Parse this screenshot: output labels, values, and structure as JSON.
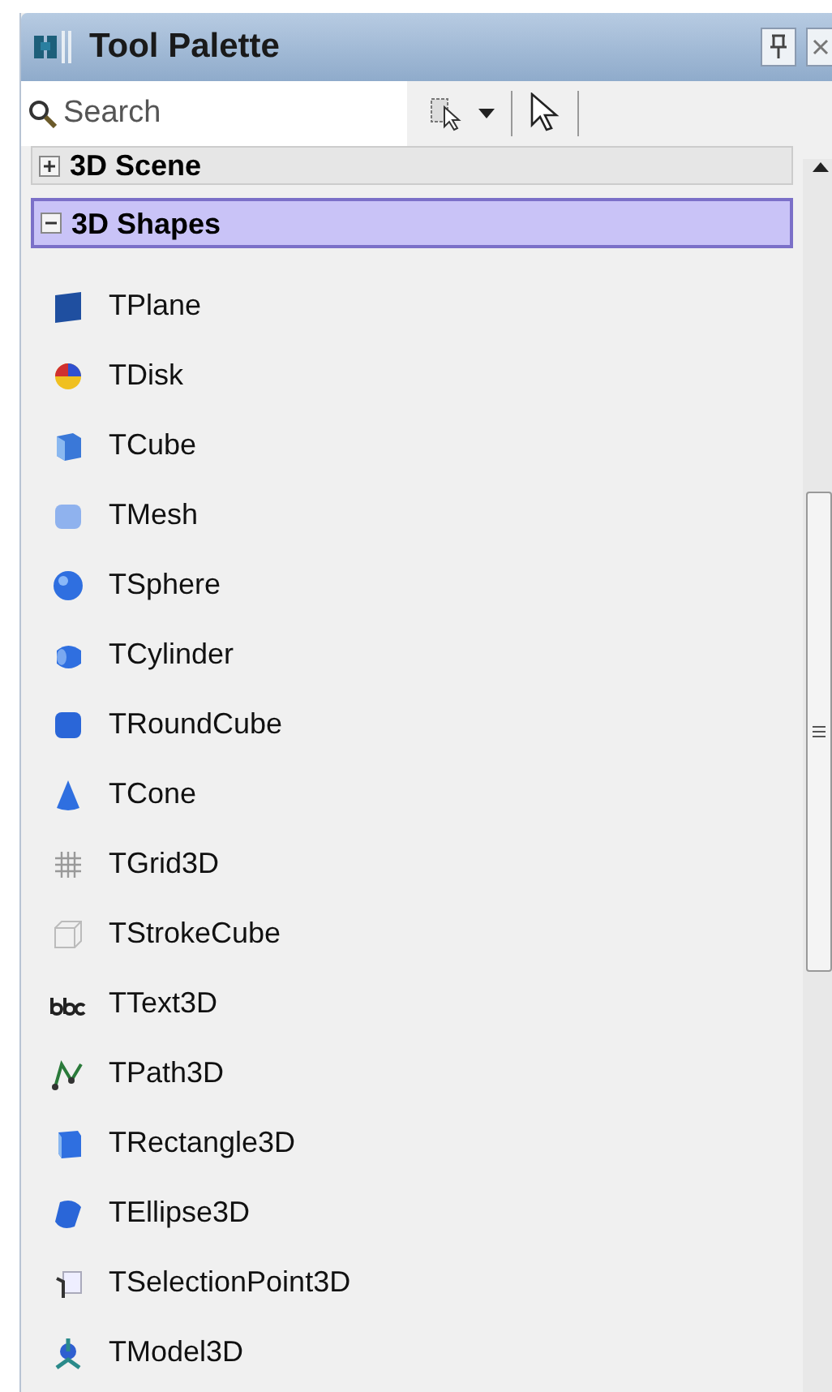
{
  "window": {
    "title": "Tool Palette"
  },
  "search": {
    "placeholder": "Search"
  },
  "categories": [
    {
      "label": "3D Scene",
      "expanded": false,
      "selected": false
    },
    {
      "label": "3D Shapes",
      "expanded": true,
      "selected": true,
      "items": [
        {
          "label": "TPlane"
        },
        {
          "label": "TDisk"
        },
        {
          "label": "TCube"
        },
        {
          "label": "TMesh"
        },
        {
          "label": "TSphere"
        },
        {
          "label": "TCylinder"
        },
        {
          "label": "TRoundCube"
        },
        {
          "label": "TCone"
        },
        {
          "label": "TGrid3D"
        },
        {
          "label": "TStrokeCube"
        },
        {
          "label": "TText3D"
        },
        {
          "label": "TPath3D"
        },
        {
          "label": "TRectangle3D"
        },
        {
          "label": "TEllipse3D"
        },
        {
          "label": "TSelectionPoint3D"
        },
        {
          "label": "TModel3D"
        }
      ]
    }
  ]
}
